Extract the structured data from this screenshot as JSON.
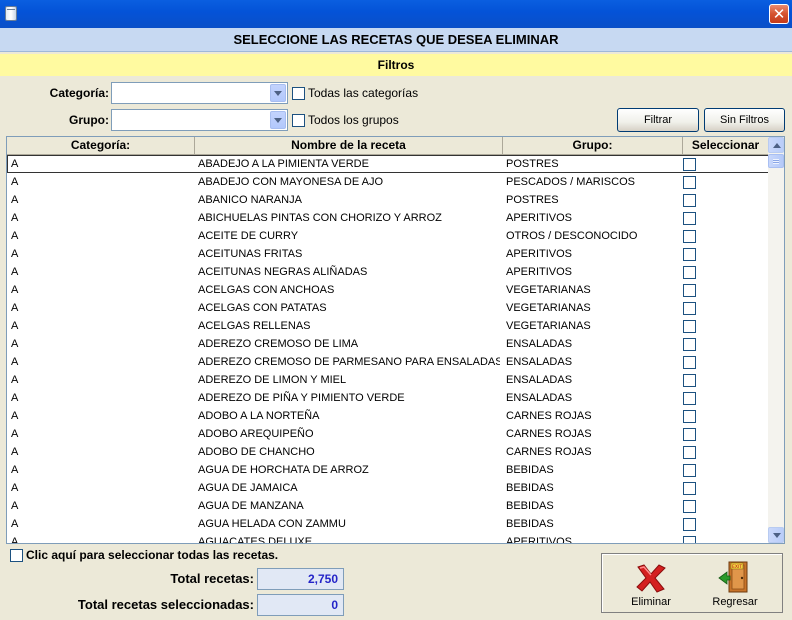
{
  "window": {
    "close_glyph": "✕"
  },
  "header": {
    "title": "SELECCIONE LAS RECETAS QUE DESEA ELIMINAR"
  },
  "filters": {
    "band_title": "Filtros",
    "categoria_label": "Categoría:",
    "categoria_value": "",
    "grupo_label": "Grupo:",
    "grupo_value": "",
    "todas_categorias_label": "Todas las categorías",
    "todos_grupos_label": "Todos los grupos",
    "filtrar_button": "Filtrar",
    "sin_filtros_button": "Sin Filtros"
  },
  "grid": {
    "columns": [
      "Categoría:",
      "Nombre de la receta",
      "Grupo:",
      "Seleccionar"
    ],
    "rows": [
      {
        "categoria": "A",
        "nombre": "ABADEJO A LA PIMIENTA VERDE",
        "grupo": "POSTRES",
        "selected": true
      },
      {
        "categoria": "A",
        "nombre": "ABADEJO CON MAYONESA DE AJO",
        "grupo": "PESCADOS / MARISCOS"
      },
      {
        "categoria": "A",
        "nombre": "ABANICO NARANJA",
        "grupo": "POSTRES"
      },
      {
        "categoria": "A",
        "nombre": "ABICHUELAS PINTAS CON CHORIZO Y ARROZ",
        "grupo": "APERITIVOS"
      },
      {
        "categoria": "A",
        "nombre": "ACEITE DE CURRY",
        "grupo": "OTROS / DESCONOCIDO"
      },
      {
        "categoria": "A",
        "nombre": "ACEITUNAS FRITAS",
        "grupo": "APERITIVOS"
      },
      {
        "categoria": "A",
        "nombre": "ACEITUNAS NEGRAS ALIÑADAS",
        "grupo": "APERITIVOS"
      },
      {
        "categoria": "A",
        "nombre": "ACELGAS CON ANCHOAS",
        "grupo": "VEGETARIANAS"
      },
      {
        "categoria": "A",
        "nombre": "ACELGAS CON PATATAS",
        "grupo": "VEGETARIANAS"
      },
      {
        "categoria": "A",
        "nombre": "ACELGAS RELLENAS",
        "grupo": "VEGETARIANAS"
      },
      {
        "categoria": "A",
        "nombre": "ADEREZO CREMOSO DE LIMA",
        "grupo": "ENSALADAS"
      },
      {
        "categoria": "A",
        "nombre": "ADEREZO CREMOSO DE PARMESANO PARA ENSALADAS",
        "grupo": "ENSALADAS"
      },
      {
        "categoria": "A",
        "nombre": "ADEREZO DE LIMON Y MIEL",
        "grupo": "ENSALADAS"
      },
      {
        "categoria": "A",
        "nombre": "ADEREZO DE PIÑA Y PIMIENTO VERDE",
        "grupo": "ENSALADAS"
      },
      {
        "categoria": "A",
        "nombre": "ADOBO A LA NORTEÑA",
        "grupo": "CARNES ROJAS"
      },
      {
        "categoria": "A",
        "nombre": "ADOBO AREQUIPEÑO",
        "grupo": "CARNES ROJAS"
      },
      {
        "categoria": "A",
        "nombre": "ADOBO DE CHANCHO",
        "grupo": "CARNES ROJAS"
      },
      {
        "categoria": "A",
        "nombre": "AGUA DE HORCHATA DE ARROZ",
        "grupo": "BEBIDAS"
      },
      {
        "categoria": "A",
        "nombre": "AGUA DE JAMAICA",
        "grupo": "BEBIDAS"
      },
      {
        "categoria": "A",
        "nombre": "AGUA DE MANZANA",
        "grupo": "BEBIDAS"
      },
      {
        "categoria": "A",
        "nombre": "AGUA HELADA CON ZAMMU",
        "grupo": "BEBIDAS"
      },
      {
        "categoria": "A",
        "nombre": "AGUACATES DELUXE",
        "grupo": "APERITIVOS"
      }
    ]
  },
  "footer": {
    "select_all_label": "Clic aquí para seleccionar todas las recetas.",
    "total_recetas_label": "Total recetas:",
    "total_recetas_value": "2,750",
    "total_seleccionadas_label": "Total recetas seleccionadas:",
    "total_seleccionadas_value": "0",
    "eliminar_label": "Eliminar",
    "regresar_label": "Regresar",
    "exit_sign_text": "EXIT"
  },
  "colors": {
    "titlebar": "#0453d8",
    "header_band": "#c7d9f2",
    "filters_band": "#fffaa0",
    "total_value_text": "#2424c8",
    "eliminar_icon": "#d42020"
  }
}
